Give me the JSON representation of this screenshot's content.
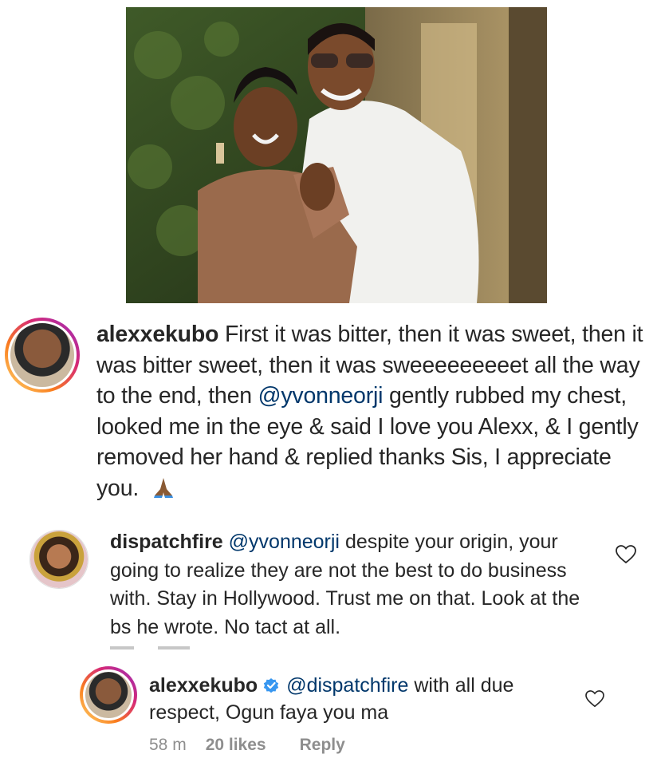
{
  "post": {
    "image_alt_subject": "couple-photo",
    "caption": {
      "username": "alexxekubo",
      "text_1": "First it was bitter, then it was sweet, then it was bitter sweet, then it was sweeeeeeeeet all the way to the end, then ",
      "mention": "@yvonneorji",
      "text_2": " gently rubbed my chest, looked me in the eye & said I love you Alexx, & I gently removed her hand & replied thanks Sis, I appreciate you."
    }
  },
  "comments": [
    {
      "username": "dispatchfire",
      "mention": "@yvonneorji",
      "text": "  despite your origin, your going to realize they are not the best to do business with.  Stay in Hollywood.  Trust me on that.  Look at the bs he wrote.  No tact at all."
    },
    {
      "username": "alexxekubo",
      "verified": true,
      "mention": "@dispatchfire",
      "text": " with all due respect, Ogun faya you ma",
      "time": "58 m",
      "likes": "20 likes",
      "reply_label": "Reply"
    }
  ],
  "colors": {
    "mention": "#00376b",
    "verified": "#3897f0",
    "meta": "#8e8e8e"
  },
  "icons": [
    "heart-icon",
    "verified-badge-icon",
    "praying-hands-emoji"
  ]
}
